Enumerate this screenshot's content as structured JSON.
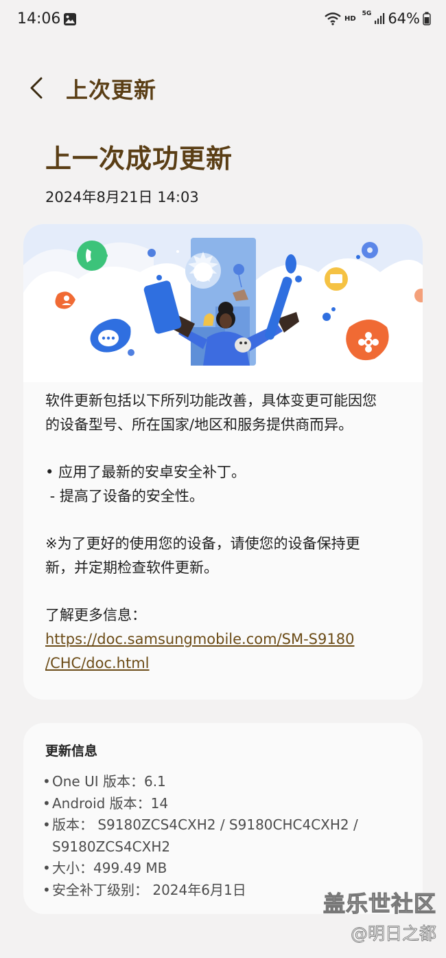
{
  "status_bar": {
    "time": "14:06",
    "hd": "HD",
    "network": "5G",
    "battery": "64%"
  },
  "header": {
    "title": "上次更新"
  },
  "hero": {
    "title": "上一次成功更新",
    "date": "2024年8月21日 14:03"
  },
  "content": {
    "intro_1": "软件更新包括以下所列功能改善，具体变更可能因您",
    "intro_2": "的设备型号、所在国家/地区和服务提供商而异。",
    "item_1": "• 应用了最新的安卓安全补丁。",
    "item_1_sub": " - 提高了设备的安全性。",
    "note_1": "※为了更好的使用您的设备，请使您的设备保持更",
    "note_2": "新，并定期检查软件更新。",
    "more_label": "了解更多信息：",
    "link_1": "https://doc.samsungmobile.com/SM-S9180",
    "link_2": "/CHC/doc.html"
  },
  "info": {
    "title": "更新信息",
    "bullet": "•",
    "one_ui": "One UI 版本：6.1",
    "android": "Android 版本：14",
    "version_1": "版本： S9180ZCS4CXH2 / S9180CHC4CXH2 /",
    "version_2": "S9180ZCS4CXH2",
    "size": "大小：499.49 MB",
    "security": "安全补丁级别： 2024年6月1日"
  },
  "watermark": {
    "line1": "盖乐世社区",
    "line2": "@明日之都"
  },
  "colors": {
    "accent": "#5a3e15",
    "background": "#f3f2f2",
    "card": "#fafafa",
    "link": "#6b4b16",
    "illus_blue": "#2f6fe0",
    "illus_orange": "#f06a34"
  }
}
